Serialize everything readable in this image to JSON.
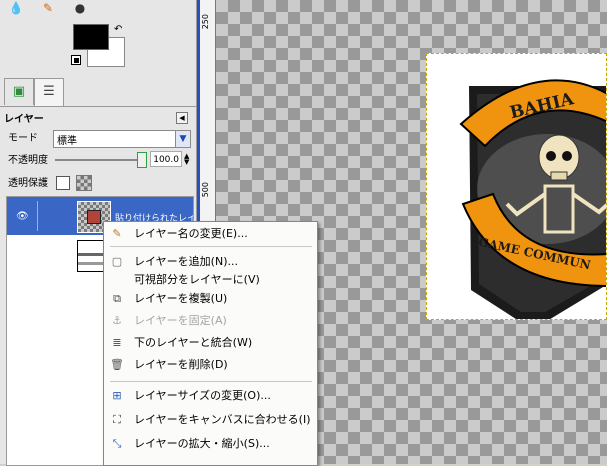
{
  "toolbox": {
    "tools": [
      {
        "icon": "blur-drop-icon",
        "glyph": "💧"
      },
      {
        "icon": "smudge-icon",
        "glyph": "✎"
      },
      {
        "icon": "dodge-burn-icon",
        "glyph": "●"
      }
    ],
    "fg_color": "#000000",
    "bg_color": "#ffffff"
  },
  "dock": {
    "tab_icons": [
      "channels-tab-icon",
      "layers-tab-icon"
    ],
    "panel_title": "レイヤー",
    "mode_label": "モード",
    "mode_value": "標準",
    "opacity_label": "不透明度",
    "opacity_value": "100.0",
    "opacity_level": 1.0,
    "lock_label": "透明保護",
    "layers": [
      {
        "name": "貼り付けられたレイヤー",
        "visible": true,
        "selected": true
      },
      {
        "name": "",
        "visible": false,
        "selected": false
      }
    ]
  },
  "ruler": {
    "ticks": [
      "250",
      "500"
    ]
  },
  "canvas": {
    "image_text_top": "BAHIA",
    "image_text_banner": "GAME COMMUN",
    "colors": {
      "orange": "#f0930f",
      "shield": "#1b1b1b",
      "bone": "#efe3c0"
    }
  },
  "context_menu": {
    "items": [
      {
        "icon": "edit-name-icon",
        "label": "レイヤー名の変更(E)...",
        "enabled": true
      },
      {
        "separator": true
      },
      {
        "icon": "new-layer-icon",
        "label": "レイヤーを追加(N)...",
        "enabled": true
      },
      {
        "icon": "",
        "label": "可視部分をレイヤーに(V)",
        "enabled": true
      },
      {
        "icon": "duplicate-layer-icon",
        "label": "レイヤーを複製(U)",
        "enabled": true
      },
      {
        "icon": "anchor-layer-icon",
        "label": "レイヤーを固定(A)",
        "enabled": false
      },
      {
        "icon": "merge-down-icon",
        "label": "下のレイヤーと統合(W)",
        "enabled": true
      },
      {
        "icon": "delete-layer-icon",
        "label": "レイヤーを削除(D)",
        "enabled": true
      },
      {
        "separator": true
      },
      {
        "icon": "layer-boundary-size-icon",
        "label": "レイヤーサイズの変更(O)...",
        "enabled": true
      },
      {
        "icon": "layer-to-image-size-icon",
        "label": "レイヤーをキャンバスに合わせる(I)",
        "enabled": true
      },
      {
        "icon": "scale-layer-icon",
        "label": "レイヤーの拡大・縮小(S)...",
        "enabled": true
      }
    ]
  }
}
